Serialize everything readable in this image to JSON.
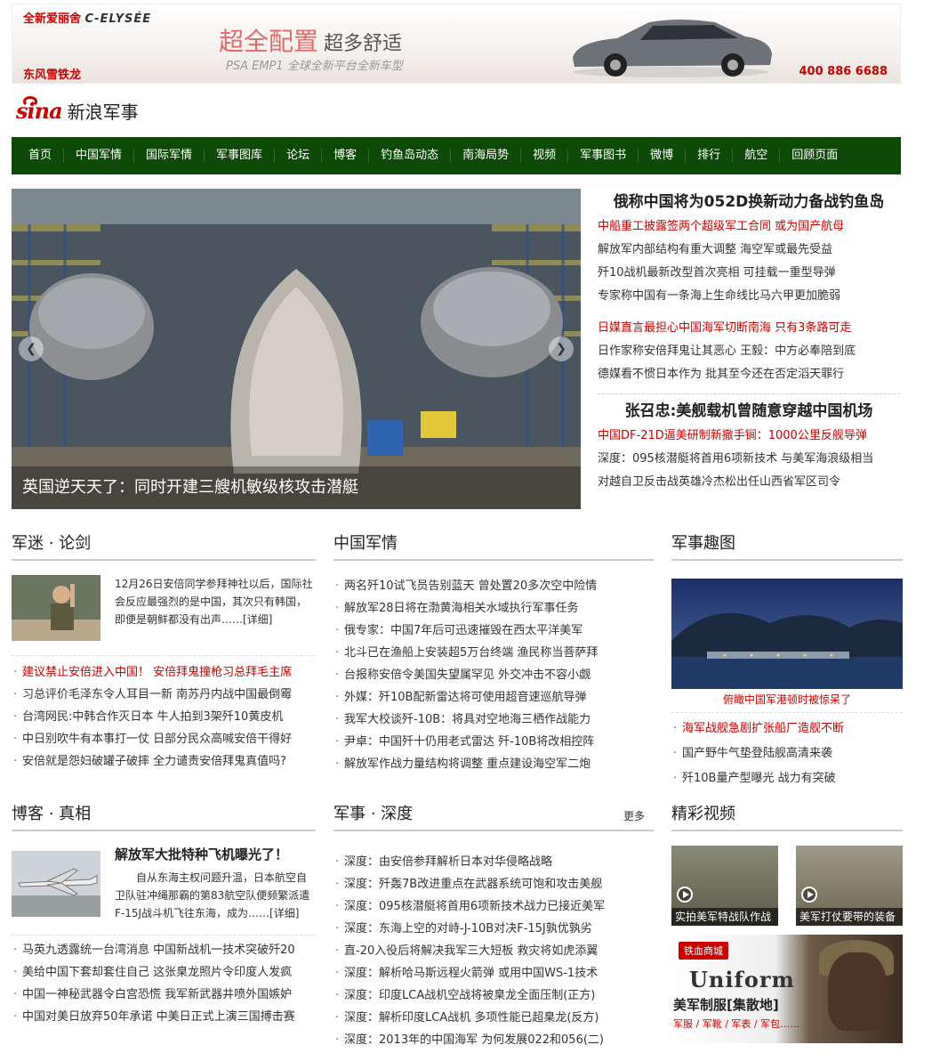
{
  "ad": {
    "brand": "全新爱丽舍",
    "brand_en": "C-ELYSÉE",
    "maker": "东风雪铁龙",
    "slogan_main": "超全配置",
    "slogan_side": "超多舒适",
    "sub": "PSA EMP1 全球全新平台全新车型",
    "phone": "400 886 6688"
  },
  "logo": {
    "sina": "sina",
    "name": "新浪军事"
  },
  "nav": [
    "首页",
    "中国军情",
    "国际军情",
    "军事图库",
    "论坛",
    "博客",
    "钓鱼岛动态",
    "南海局势",
    "视频",
    "军事图书",
    "微博",
    "排行",
    "航空",
    "回顾页面"
  ],
  "focus": {
    "caption": "英国逆天天了：同时开建三艘机敏级核攻击潜艇",
    "prev": "❮",
    "next": "❯"
  },
  "headlines": {
    "main1": "俄称中国将为052D换新动力备战钓鱼岛",
    "group1": [
      {
        "text": "中船重工披露签两个超级军工合同 或为国产航母",
        "red": true
      },
      {
        "text": "解放军内部结构有重大调整 海空军或最先受益",
        "red": false
      },
      {
        "text": "歼10战机最新改型首次亮相 可挂载一重型导弹",
        "red": false
      },
      {
        "text": "专家称中国有一条海上生命线比马六甲更加脆弱",
        "red": false
      }
    ],
    "group2": [
      {
        "text": "日媒直言最担心中国海军切断南海 只有3条路可走",
        "red": true
      },
      {
        "text": "日作家称安倍拜鬼让其恶心 王毅：中方必奉陪到底",
        "red": false
      },
      {
        "text": "德媒看不惯日本作为 批其至今还在否定滔天罪行",
        "red": false
      }
    ],
    "main2": "张召忠:美舰载机曾随意穿越中国机场",
    "group3": [
      {
        "text": "中国DF-21D逼美研制新撒手锏：1000公里反舰导弹",
        "red": true
      },
      {
        "text": "深度：095核潜艇将首用6项新技术 与美军海浪级相当",
        "red": false
      },
      {
        "text": "对越自卫反击战英雄冷杰松出任山西省军区司令",
        "red": false
      }
    ]
  },
  "junmi": {
    "title": "军迷 · 论剑",
    "text": "12月26日安倍同学参拜神社以后，国际社会反应最强烈的是中国，其次只有韩国，即便是朝鲜都没有出声……[详细]",
    "items": [
      {
        "text": "建议禁止安倍进入中国！ 安倍拜鬼撞枪习总拜毛主席",
        "red": true
      },
      {
        "text": "习总评价毛泽东令人耳目一新 南苏丹内战中国最倒霉",
        "red": false
      },
      {
        "text": "台湾网民:中韩合作灭日本 牛人拍到3架歼10黄皮机",
        "red": false
      },
      {
        "text": "中日别吹牛有本事打一仗 日部分民众高喊安倍干得好",
        "red": false
      },
      {
        "text": "安倍就是怨妇破罐子破摔 全力谴责安倍拜鬼真值吗?",
        "red": false
      }
    ]
  },
  "china": {
    "title": "中国军情",
    "items": [
      "两名歼10试飞员告别蓝天 曾处置20多次空中险情",
      "解放军28日将在渤黄海相关水域执行军事任务",
      "俄专家：中国7年后可迅速摧毁在西太平洋美军",
      "北斗已在渔船上安装超5万台终端 渔民称当菩萨拜",
      "台报称安倍令美国失望属罕见 外交冲击不容小觑",
      "外媒：歼10B配新雷达将可使用超音速巡航导弹",
      "我军大校谈歼-10B：将具对空地海三栖作战能力",
      "尹卓：中国歼十仍用老式雷达 歼-10B将改相控阵",
      "解放军作战力量结构将调整 重点建设海空军二炮"
    ]
  },
  "quwei": {
    "title": "军事趣图",
    "caption": "俯瞰中国军港顿时被惊呆了",
    "items": [
      {
        "text": "海军战舰急剧扩张船厂造舰不断",
        "red": true
      },
      {
        "text": "国产野牛气垫登陆舰高清来袭",
        "red": false
      },
      {
        "text": "歼10B量产型曝光 战力有突破",
        "red": false
      }
    ]
  },
  "boke": {
    "title": "博客 · 真相",
    "headline": "解放军大批特种飞机曝光了！",
    "text": "自从东海主权问题升温，日本航空自卫队驻冲绳那霸的第83航空队便频繁派遣F-15J战斗机飞往东海，成为……[详细]",
    "items": [
      "马英九透露统一台湾消息 中国新战机一技术突破歼20",
      "美给中国下套却套住自己 这张臬龙照片令印度人发疯",
      "中国一神秘武器令白宫恐慌 我军新武器井喷外国嫉妒",
      "中国对美日放弃50年承诺 中美日正式上演三国搏击赛"
    ]
  },
  "shendu": {
    "title": "军事 · 深度",
    "more": "更多",
    "items": [
      "深度：由安倍参拜解析日本对华侵略战略",
      "深度：歼轰7B改进重点在武器系统可饱和攻击美舰",
      "深度：095核潜艇将首用6项新技术战力已接近美军",
      "深度：东海上空的对峙-J-10B对决F-15J孰优孰劣",
      "直-20入役后将解决我军三大短板 救灾将如虎添翼",
      "深度：解析哈马斯远程火箭弹 或用中国WS-1技术",
      "深度：印度LCA战机空战将被臬龙全面压制(正方)",
      "深度：解析印度LCA战机 多项性能已超臬龙(反方)",
      "深度：2013年的中国海军 为何发展022和056(二)"
    ]
  },
  "video": {
    "title": "精彩视频",
    "v1": "实拍美军特战队作战",
    "v2": "美军打仗要带的装备",
    "promo_badge": "铁血商城",
    "promo_title": "Uniform",
    "promo_sub": "美军制服[集散地]",
    "promo_line": "军服 / 军靴 / 军表 / 军包……"
  }
}
